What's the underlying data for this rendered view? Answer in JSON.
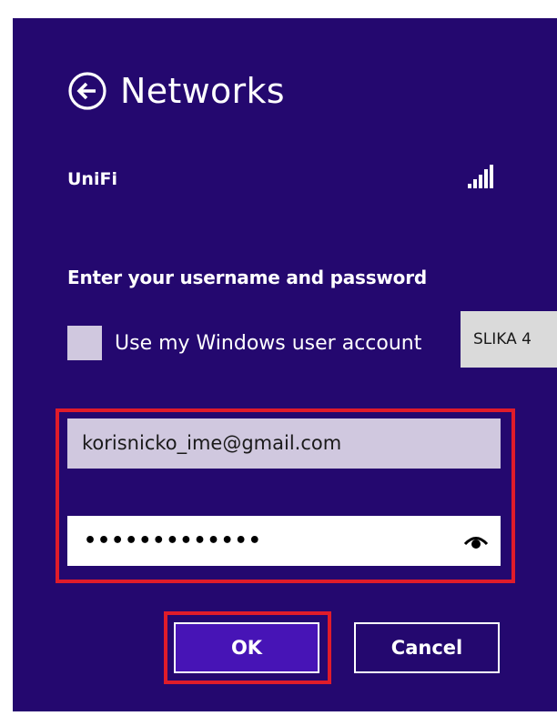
{
  "header": {
    "title": "Networks",
    "back_icon": "back-arrow-circle-icon"
  },
  "network": {
    "name": "UniFi",
    "signal_icon": "wifi-signal-icon"
  },
  "form": {
    "prompt": "Enter your username and password",
    "use_windows_account_label": "Use my Windows user account",
    "use_windows_account_checked": false,
    "username_value": "korisnicko_ime@gmail.com",
    "password_masked": "•••••••••••••",
    "reveal_icon": "eye-reveal-icon"
  },
  "buttons": {
    "ok_label": "OK",
    "cancel_label": "Cancel"
  },
  "badge": {
    "label": "SLIKA 4"
  },
  "colors": {
    "panel_background": "#24086f",
    "ok_button_background": "#4714b6",
    "highlight_frame": "#e01c2a",
    "field_background": "#d0c8df",
    "badge_background": "#dadada"
  }
}
